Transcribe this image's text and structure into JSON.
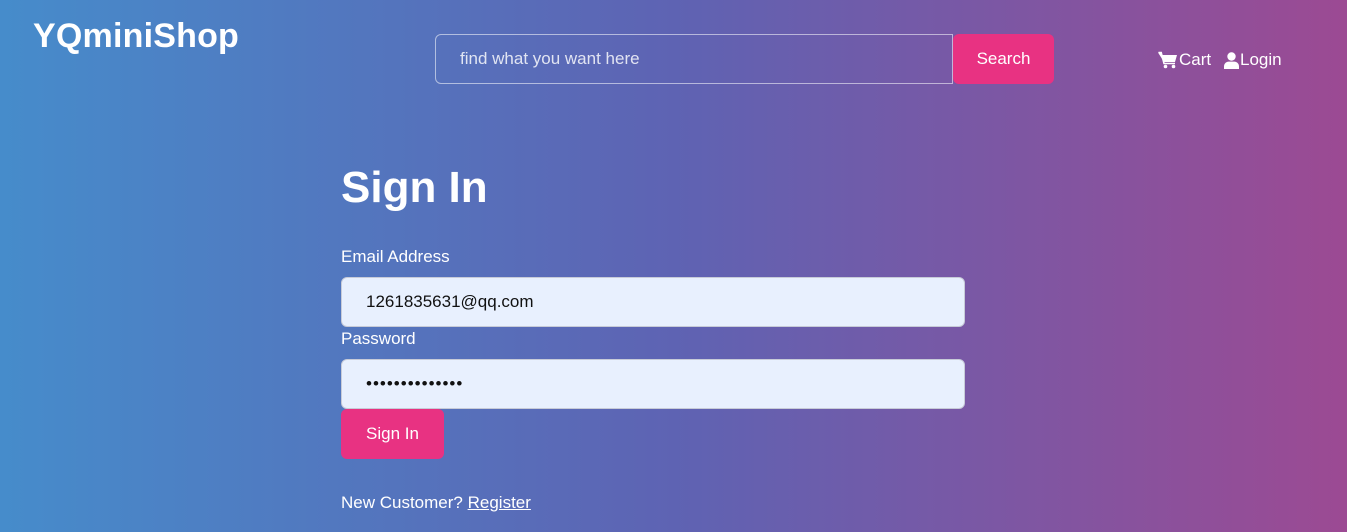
{
  "header": {
    "brand": "YQminiShop",
    "search": {
      "placeholder": "find what you want here",
      "value": "",
      "button_label": "Search"
    },
    "nav": {
      "cart_label": "Cart",
      "cart_icon": "shopping-cart-icon",
      "login_label": "Login",
      "login_icon": "user-icon"
    }
  },
  "form": {
    "title": "Sign In",
    "email_label": "Email Address",
    "email_value": "1261835631@qq.com",
    "password_label": "Password",
    "password_value": "••••••••••••••",
    "submit_label": "Sign In",
    "new_customer_text": "New Customer?",
    "register_link": "Register"
  },
  "colors": {
    "gradient_start": "#468ccb",
    "gradient_mid": "#5e63b3",
    "gradient_end": "#9c4a93",
    "accent": "#e83282",
    "field_background": "#e8f0fe"
  }
}
